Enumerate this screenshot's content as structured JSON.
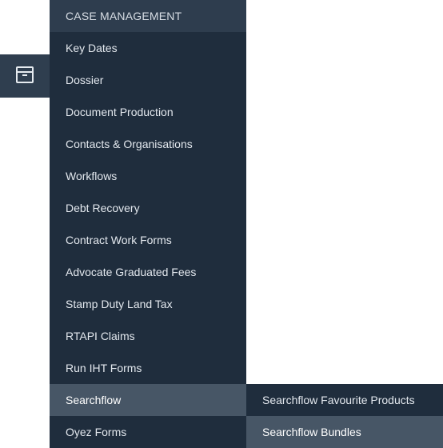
{
  "rail": {
    "icon": "calendar-icon"
  },
  "menu": {
    "header": "CASE MANAGEMENT",
    "items": [
      {
        "label": "Key Dates"
      },
      {
        "label": "Dossier"
      },
      {
        "label": "Document Production"
      },
      {
        "label": "Contacts & Organisations"
      },
      {
        "label": "Workflows"
      },
      {
        "label": "Debt Recovery"
      },
      {
        "label": "Contract Work Forms"
      },
      {
        "label": "Advocate Graduated Fees"
      },
      {
        "label": "Stamp Duty Land Tax"
      },
      {
        "label": "RTAPI Claims"
      },
      {
        "label": "Run IHT Forms"
      },
      {
        "label": "Searchflow"
      },
      {
        "label": "Oyez Forms"
      }
    ]
  },
  "submenu": {
    "items": [
      {
        "label": "Searchflow Favourite Products"
      },
      {
        "label": "Searchflow Bundles"
      }
    ]
  },
  "colors": {
    "menu_bg": "#1f2d3d",
    "header_bg": "#2e3d4e",
    "active_bg": "#475666",
    "rail_bg": "#2f3e4f"
  }
}
